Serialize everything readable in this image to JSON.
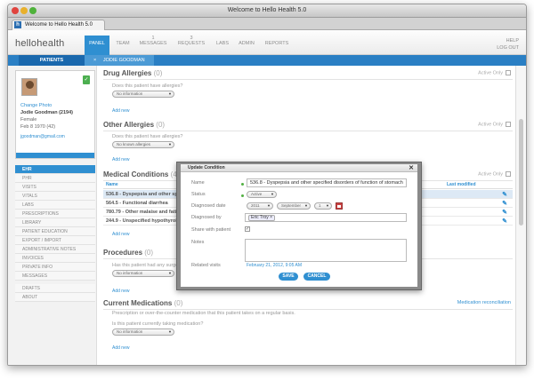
{
  "window": {
    "title": "Welcome to Hello Health 5.0"
  },
  "browser_tab": {
    "label": "Welcome to Hello Health 5.0",
    "icon": "h"
  },
  "header": {
    "logo": "hellohealth",
    "nav": [
      {
        "count": "",
        "label": "PANEL",
        "active": true
      },
      {
        "count": "",
        "label": "TEAM"
      },
      {
        "count": "1",
        "label": "MESSAGES"
      },
      {
        "count": "3",
        "label": "REQUESTS"
      },
      {
        "count": "",
        "label": "LABS"
      },
      {
        "count": "",
        "label": "ADMIN"
      },
      {
        "count": "",
        "label": "REPORTS"
      }
    ],
    "help": "HELP",
    "logout": "LOG OUT"
  },
  "patient_bar": {
    "patients": "PATIENTS",
    "close": "×",
    "current": "JODIE GOODMAN"
  },
  "sidebar": {
    "change_photo": "Change Photo",
    "name": "Jodie Goodman (2194)",
    "gender": "Female",
    "dob": "Feb 8 1970 (42)",
    "email": "jgoodman@gmail.com",
    "menu": [
      "EHR",
      "PHR",
      "VISITS",
      "VITALS",
      "LABS",
      "PRESCRIPTIONS",
      "LIBRARY",
      "PATIENT EDUCATION",
      "EXPORT / IMPORT",
      "ADMINISTRATIVE NOTES",
      "INVOICES",
      "PRIVATE INFO",
      "MESSAGES",
      "DRAFTS",
      "ABOUT"
    ]
  },
  "sections": {
    "drug_allergies": {
      "title": "Drug Allergies",
      "count": "(0)",
      "question": "Does this patient have allergies?",
      "select": "No information",
      "add": "Add new",
      "active_only": "Active Only"
    },
    "other_allergies": {
      "title": "Other Allergies",
      "count": "(0)",
      "question": "Does this patient have allergies?",
      "select": "No known allergies",
      "add": "Add new",
      "active_only": "Active Only"
    },
    "medical_conditions": {
      "title": "Medical Conditions",
      "count": "(4)",
      "active_only": "Active Only",
      "col_name": "Name",
      "col_modified": "Last modified",
      "rows": [
        "536.8 - Dyspepsia and other specif",
        "564.5 - Functional diarrhea",
        "780.79 - Other malaise and fatigue",
        "244.9 - Unspecified hypothyroidism"
      ],
      "add": "Add new"
    },
    "procedures": {
      "title": "Procedures",
      "count": "(0)",
      "question": "Has this patient had any surgeries or",
      "select": "No information",
      "add": "Add new"
    },
    "current_medications": {
      "title": "Current Medications",
      "count": "(0)",
      "reconciliation": "Medication reconciliation",
      "description": "Prescription or over-the-counter medication that this patient takes on a regular basis.",
      "question": "Is this patient currently taking medication?",
      "select": "No information",
      "add": "Add new"
    }
  },
  "dialog": {
    "title": "Update Condition",
    "close": "✕",
    "name_label": "Name",
    "name_value": "536.8 - Dyspepsia and other specified disorders of function of stomach",
    "status_label": "Status",
    "status_value": "Active",
    "diagnosed_date_label": "Diagnosed date",
    "date_year": "2011",
    "date_month": "September",
    "date_day": "1",
    "diagnosed_by_label": "Diagnosed by",
    "diagnosed_by_value": "Eric Troy",
    "share_label": "Share with patient",
    "share_checked": "✓",
    "notes_label": "Notes",
    "related_label": "Related visits",
    "related_value": "February 21, 2012, 9:05 AM",
    "save": "SAVE",
    "cancel": "CANCEL"
  },
  "colors": {
    "accent": "#2f8fd1",
    "required": "#52b043"
  }
}
